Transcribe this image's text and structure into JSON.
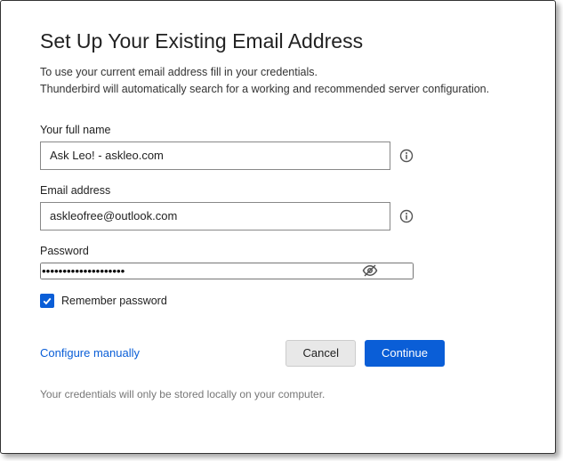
{
  "title": "Set Up Your Existing Email Address",
  "subtitle": "To use your current email address fill in your credentials.\nThunderbird will automatically search for a working and recommended server configuration.",
  "fields": {
    "name": {
      "label": "Your full name",
      "value": "Ask Leo! - askleo.com"
    },
    "email": {
      "label": "Email address",
      "value": "askleofree@outlook.com"
    },
    "password": {
      "label": "Password",
      "value": "••••••••••••••••••••"
    }
  },
  "remember": {
    "label": "Remember password",
    "checked": true
  },
  "actions": {
    "configure": "Configure manually",
    "cancel": "Cancel",
    "continue": "Continue"
  },
  "footer": "Your credentials will only be stored locally on your computer."
}
